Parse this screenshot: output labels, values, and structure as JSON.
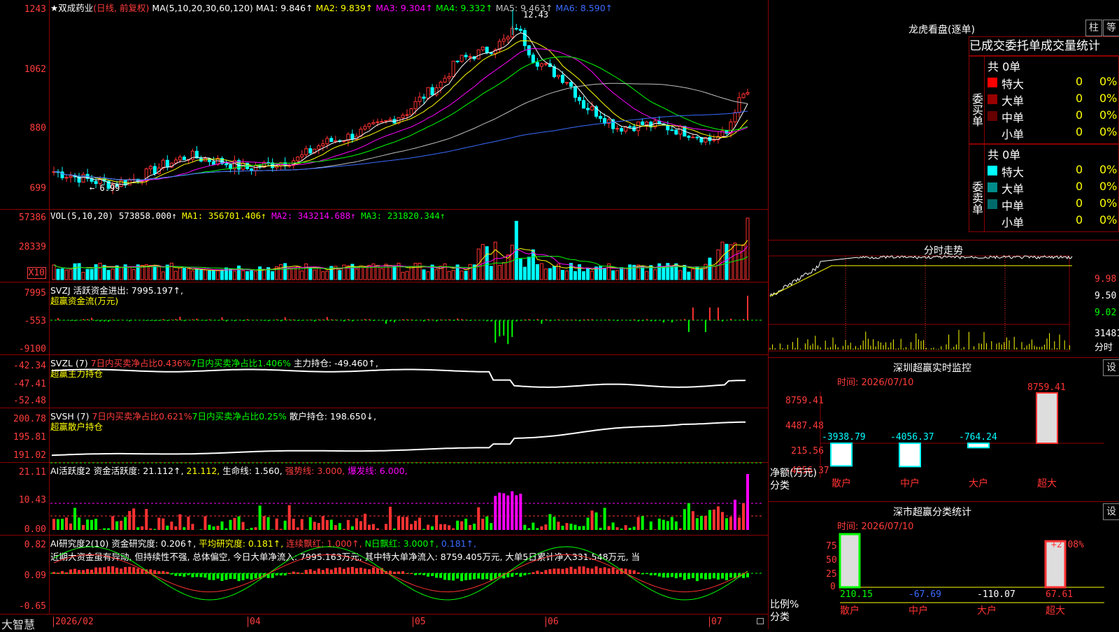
{
  "stock": {
    "star": "★",
    "name": "双成药业",
    "period": "(日线, 前复权)"
  },
  "kline": {
    "ma_params": "MA(5,10,20,30,60,120)",
    "ma": [
      {
        "label": "MA1: 9.846↑",
        "color": "#ffffff"
      },
      {
        "label": "MA2: 9.839↑",
        "color": "#ffff00"
      },
      {
        "label": "MA3: 9.304↑",
        "color": "#ff00ff"
      },
      {
        "label": "MA4: 9.332↑",
        "color": "#00ff00"
      },
      {
        "label": "MA5: 9.463↑",
        "color": "#c0c0c0"
      },
      {
        "label": "MA6: 8.590↑",
        "color": "#3a6bff"
      }
    ],
    "y_labels": [
      "1243",
      "1062",
      "880",
      "699"
    ],
    "high_label": "12.43",
    "low_label": "← 6.99"
  },
  "vol": {
    "params": "VOL(5,10,20)",
    "value": "573858.000↑",
    "ma": [
      {
        "label": "MA1: 356701.406↑",
        "color": "#ffff00"
      },
      {
        "label": "MA2: 343214.688↑",
        "color": "#ff00ff"
      },
      {
        "label": "MA3: 231820.344↑",
        "color": "#00ff00"
      }
    ],
    "y_labels": [
      "57386",
      "28339"
    ],
    "unit": "X10"
  },
  "svzj": {
    "name": "SVZJ",
    "label": "活跃资金进出: 7995.197↑,",
    "sub": "超赢资金流(万元)",
    "y_labels": [
      "7995",
      "-553",
      "-9100"
    ]
  },
  "svzl": {
    "name": "SVZL (7)",
    "a": "7日内买卖净占比0.436%",
    "b": "7日内买卖净占比1.406%",
    "c": "主力持仓: -49.460↑,",
    "sub": "超赢主力持仓",
    "y_labels": [
      "-42.34",
      "-47.41",
      "-52.48"
    ]
  },
  "svsh": {
    "name": "SVSH (7)",
    "a": "7日内买卖净占比0.621%",
    "b": "7日内买卖净占比0.25%",
    "c": "散户持仓: 198.650↓,",
    "sub": "超赢散户持仓",
    "y_labels": [
      "200.78",
      "195.81",
      "191.02"
    ]
  },
  "ai2": {
    "name": "AI活跃度2",
    "a": "资金活跃度: 21.112↑,",
    "b": "21.112,",
    "c": "生命线: 1.560,",
    "d": "强势线: 3.000,",
    "e": "爆发线: 6.000,",
    "y_labels": [
      "21.11",
      "10.43",
      "0.00"
    ]
  },
  "ai3": {
    "name": "AI研究度2(10)",
    "a": "资金研究度: 0.206↑,",
    "b": "平均研究度: 0.181↑,",
    "c": "连续飘红: 1.000↑,",
    "d": "N日飘红: 3.000↑,",
    "e": "0.181↑,",
    "note": "近期大资金虽有异动, 但持续性不强, 总体偏空, 今日大单净流入: 7995.163万元, 其中特大单净流入: 8759.405万元, 大单5日累计净入331.548万元, 当",
    "y_labels": [
      "0.82",
      "0.09",
      "-0.65"
    ]
  },
  "bottom": {
    "brand": "大智慧",
    "dates": [
      "2026/02",
      "04",
      "05",
      "06",
      "07"
    ]
  },
  "lhb": {
    "title": "龙虎看盘(逐单)",
    "btn1": "柱",
    "btn2": "等",
    "header": "已成交委托单成交量统计",
    "buy": {
      "side": "委买单",
      "total": "共 0单",
      "rows": [
        {
          "name": "特大",
          "count": "0",
          "pct": "0%",
          "color": "#ff0000"
        },
        {
          "name": "大单",
          "count": "0",
          "pct": "0%",
          "color": "#990000"
        },
        {
          "name": "中单",
          "count": "0",
          "pct": "0%",
          "color": "#660000"
        },
        {
          "name": "小单",
          "count": "0",
          "pct": "0%",
          "color": ""
        }
      ]
    },
    "sell": {
      "side": "委卖单",
      "total": "共 0单",
      "rows": [
        {
          "name": "特大",
          "count": "0",
          "pct": "0%",
          "color": "#00ffff"
        },
        {
          "name": "大单",
          "count": "0",
          "pct": "0%",
          "color": "#008b8b"
        },
        {
          "name": "中单",
          "count": "0",
          "pct": "0%",
          "color": "#006b6b"
        },
        {
          "name": "小单",
          "count": "0",
          "pct": "0%",
          "color": ""
        }
      ]
    }
  },
  "minute": {
    "title": "分时走势",
    "y_labels": [
      "9.98",
      "9.50",
      "9.02"
    ],
    "vol_label": "31481",
    "vol_unit": "分时"
  },
  "sz_monitor": {
    "title": "深圳超赢实时监控",
    "btn": "设",
    "time": "时间: 2026/07/10",
    "y_labels": [
      "8759.41",
      "4487.48",
      "215.56",
      "-4056.37"
    ],
    "bars": [
      {
        "name": "散户",
        "value": "-3938.79"
      },
      {
        "name": "中户",
        "value": "-4056.37"
      },
      {
        "name": "大户",
        "value": "-764.24"
      },
      {
        "name": "超大",
        "value": "8759.41"
      }
    ],
    "axis_title": "净额(万元)",
    "axis_sub": "分类"
  },
  "sz_class": {
    "title": "深市超赢分类统计",
    "btn": "设",
    "time": "时间: 2026/07/10",
    "y_labels": [
      "75",
      "50",
      "25",
      "0"
    ],
    "bars": [
      {
        "name": "散户",
        "value": "210.15"
      },
      {
        "name": "中户",
        "value": "-67.69"
      },
      {
        "name": "大户",
        "value": "-110.07"
      },
      {
        "name": "超大",
        "value": "67.61"
      }
    ],
    "pct_label": "+2.08%",
    "axis_title": "比例%",
    "axis_sub": "分类"
  },
  "chart_data": [
    {
      "type": "candlestick",
      "ylim": [
        6.99,
        12.43
      ],
      "y_ticks": [
        12.43,
        10.62,
        8.8,
        6.99
      ],
      "x_ticks": [
        "2026/02",
        "04",
        "05",
        "06",
        "07"
      ]
    },
    {
      "type": "bar",
      "name": "VOL",
      "ylim": [
        0,
        57386
      ]
    },
    {
      "type": "bar",
      "name": "SVZJ",
      "ylim": [
        -9100,
        7995
      ]
    },
    {
      "type": "line",
      "name": "SVZL",
      "ylim": [
        -52.48,
        -42.34
      ]
    },
    {
      "type": "line",
      "name": "SVSH",
      "ylim": [
        191.02,
        200.78
      ]
    },
    {
      "type": "bar",
      "name": "AI活跃度2",
      "ylim": [
        0,
        21.11
      ]
    },
    {
      "type": "bar",
      "name": "AI研究度2(10)",
      "ylim": [
        -0.65,
        0.82
      ]
    },
    {
      "type": "bar",
      "name": "深圳超赢实时监控",
      "categories": [
        "散户",
        "中户",
        "大户",
        "超大"
      ],
      "values": [
        -3938.79,
        -4056.37,
        -764.24,
        8759.41
      ]
    },
    {
      "type": "bar",
      "name": "深市超赢分类统计",
      "categories": [
        "散户",
        "中户",
        "大户",
        "超大"
      ],
      "values": [
        210.15,
        -67.69,
        -110.07,
        67.61
      ]
    }
  ]
}
